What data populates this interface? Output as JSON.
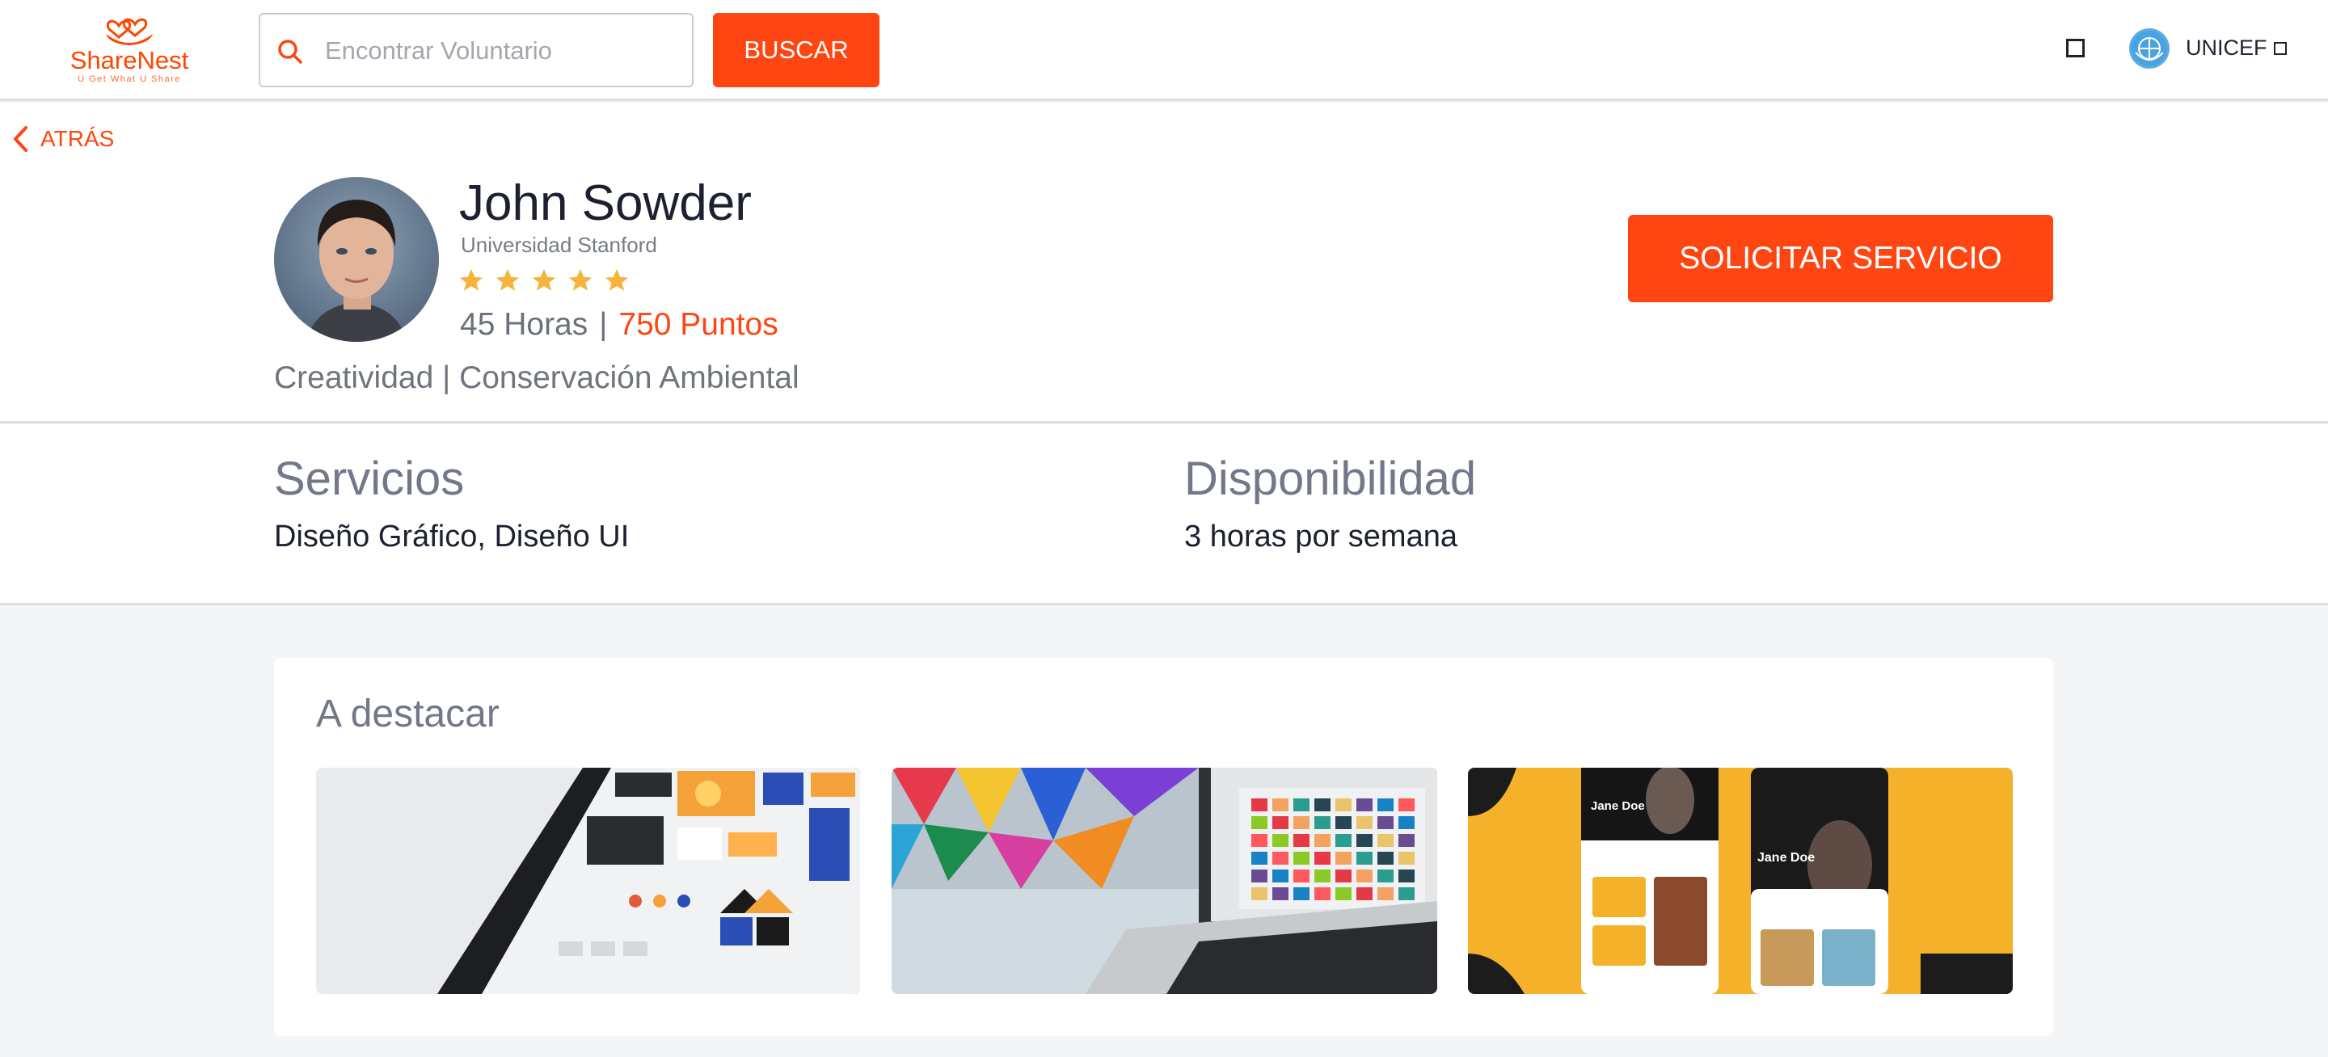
{
  "header": {
    "logo": {
      "name": "ShareNest",
      "tagline": "U Get What U Share",
      "icon": "nest-hearts-icon"
    },
    "search": {
      "placeholder": "Encontrar Voluntario",
      "value": "",
      "icon": "search-icon"
    },
    "search_button": "BUSCAR",
    "square_icon": "square-icon",
    "org": {
      "name": "UNICEF",
      "icon": "globe-emblem-icon",
      "caret_icon": "square-caret-icon"
    }
  },
  "nav": {
    "back_label": "ATRÁS",
    "back_icon": "chevron-left-icon"
  },
  "profile": {
    "name": "John Sowder",
    "school": "Universidad Stanford",
    "rating": 5,
    "rating_max": 5,
    "hours": "45 Horas",
    "separator": "|",
    "points": "750 Puntos",
    "interests": "Creatividad | Conservación Ambiental",
    "request_button": "SOLICITAR SERVICIO"
  },
  "info": {
    "services_title": "Servicios",
    "services_value": "Diseño Gráfico, Diseño UI",
    "availability_title": "Disponibilidad",
    "availability_value": "3 horas por semana"
  },
  "featured": {
    "title": "A destacar",
    "items": [
      {
        "name": "featured-image-tablet-design"
      },
      {
        "name": "featured-image-laptop-pattern"
      },
      {
        "name": "featured-image-mobile-app",
        "card_name_1": "Jane Doe",
        "card_name_2": "Jane Doe"
      }
    ]
  },
  "colors": {
    "accent": "#ff4512",
    "star": "#f5b43a",
    "muted_text": "#72788a",
    "background": "#f4f5f7"
  }
}
